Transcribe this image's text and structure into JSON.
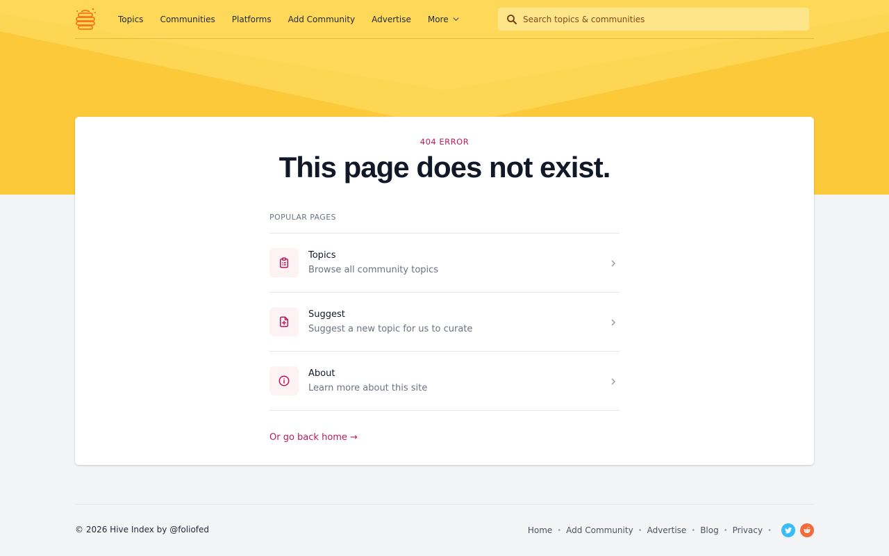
{
  "colors": {
    "brand_yellow": "#fcc93b",
    "accent": "#be185d",
    "twitter": "#38bdf8",
    "reddit": "#f26b3a"
  },
  "header": {
    "logo_icon": "beehive-icon",
    "nav": [
      {
        "label": "Topics"
      },
      {
        "label": "Communities"
      },
      {
        "label": "Platforms"
      },
      {
        "label": "Add Community"
      },
      {
        "label": "Advertise"
      },
      {
        "label": "More",
        "icon": "chevron-down-icon"
      }
    ],
    "search": {
      "placeholder": "Search topics & communities",
      "value": "",
      "icon": "search-icon"
    }
  },
  "error": {
    "code": "404 ERROR",
    "title": "This page does not exist."
  },
  "popular": {
    "label": "POPULAR PAGES",
    "items": [
      {
        "title": "Topics",
        "description": "Browse all community topics",
        "icon": "clipboard-list-icon"
      },
      {
        "title": "Suggest",
        "description": "Suggest a new topic for us to curate",
        "icon": "document-add-icon"
      },
      {
        "title": "About",
        "description": "Learn more about this site",
        "icon": "info-circle-icon"
      }
    ],
    "home_link": "Or go back home →"
  },
  "footer": {
    "copyright": "© 2026 Hive Index by @foliofed",
    "links": [
      "Home",
      "Add Community",
      "Advertise",
      "Blog",
      "Privacy"
    ],
    "separator": "•",
    "social": [
      "twitter-icon",
      "reddit-icon"
    ]
  }
}
